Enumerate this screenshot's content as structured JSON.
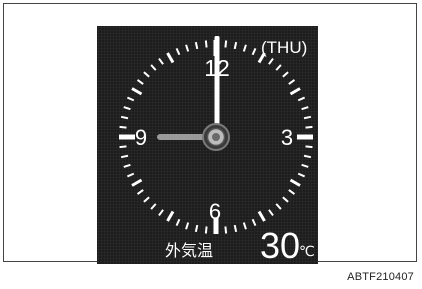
{
  "clock": {
    "day": "(THU)",
    "numeral_12": "12",
    "numeral_3": "3",
    "numeral_6": "6",
    "numeral_9": "9",
    "time": {
      "hour": 9,
      "minute": 0
    }
  },
  "temperature": {
    "label": "外気温",
    "value": "30",
    "unit": "℃"
  },
  "figure_code": "ABTF210407",
  "colors": {
    "screen_bg": "#1c1c1c",
    "foreground": "#ffffff",
    "hour_hand": "#9a9a9a"
  },
  "icons": {
    "hand_hub": "circle-hub-icon"
  }
}
